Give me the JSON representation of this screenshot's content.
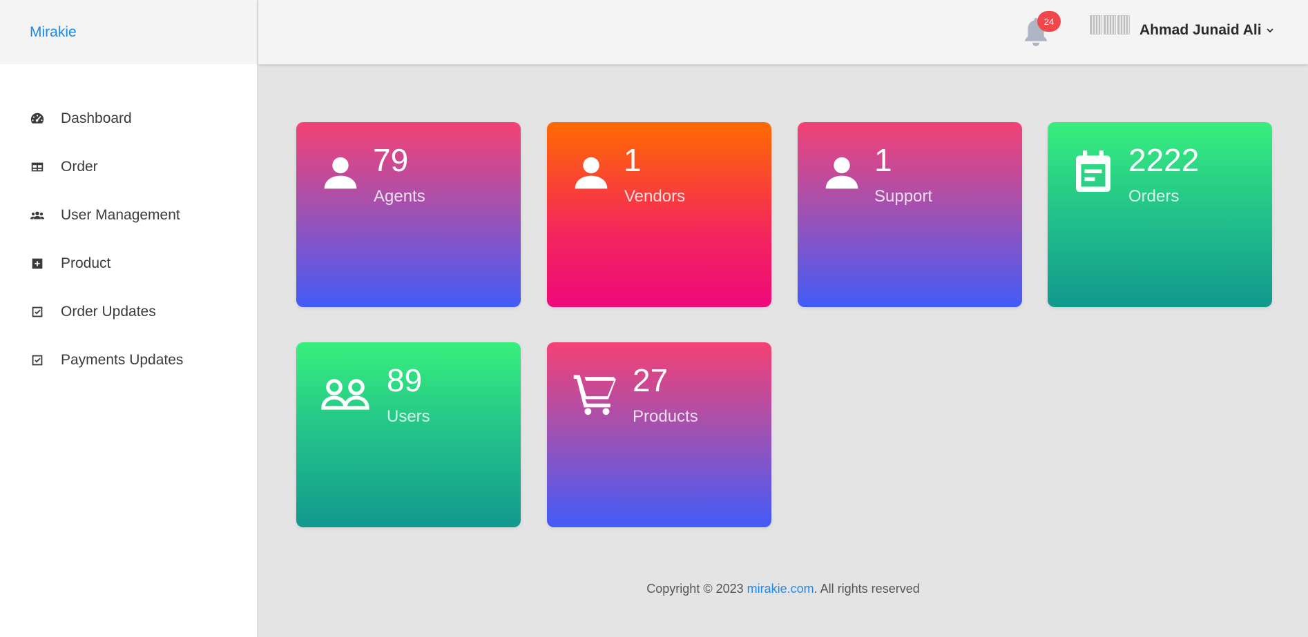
{
  "sidebar": {
    "brand": "Mirakie",
    "items": [
      {
        "label": "Dashboard",
        "icon": "dashboard-icon"
      },
      {
        "label": "Order",
        "icon": "table-icon"
      },
      {
        "label": "User Management",
        "icon": "users-icon"
      },
      {
        "label": "Product",
        "icon": "plus-square-icon"
      },
      {
        "label": "Order Updates",
        "icon": "check-square-icon"
      },
      {
        "label": "Payments Updates",
        "icon": "check-square-icon"
      }
    ]
  },
  "header": {
    "notification_count": "24",
    "user_name": "Ahmad Junaid Ali"
  },
  "cards": [
    {
      "count": "79",
      "label": "Agents",
      "icon": "user-icon"
    },
    {
      "count": "1",
      "label": "Vendors",
      "icon": "user-icon"
    },
    {
      "count": "1",
      "label": "Support",
      "icon": "user-icon"
    },
    {
      "count": "2222",
      "label": "Orders",
      "icon": "calendar-icon"
    },
    {
      "count": "89",
      "label": "Users",
      "icon": "users-icon"
    },
    {
      "count": "27",
      "label": "Products",
      "icon": "cart-icon"
    }
  ],
  "footer": {
    "prefix": "Copyright © 2023 ",
    "link": "mirakie.com",
    "suffix": ". All rights reserved"
  },
  "colors": {
    "accent": "#1e88e5",
    "badge": "#f0474c",
    "pink_gradient": [
      "#f44174",
      "#425bf8"
    ],
    "orange_gradient": [
      "#ff6a00",
      "#ee0979"
    ],
    "green_gradient": [
      "#38ef7d",
      "#11998e"
    ]
  }
}
